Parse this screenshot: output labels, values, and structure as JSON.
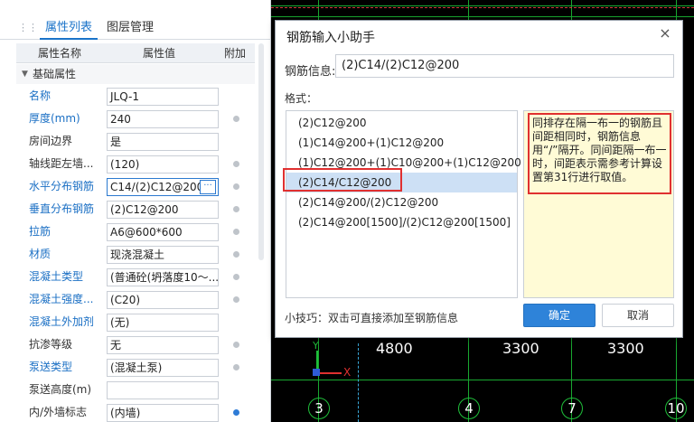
{
  "panel": {
    "tabs": [
      "属性列表",
      "图层管理"
    ],
    "columns": {
      "name": "属性名称",
      "value": "属性值",
      "extra": "附加"
    },
    "group_label": "基础属性",
    "rows": [
      {
        "name": "名称",
        "value": "JLQ-1"
      },
      {
        "name": "厚度(mm)",
        "value": "240"
      },
      {
        "name": "房间边界",
        "value": "是"
      },
      {
        "name": "轴线距左墙...",
        "value": "(120)"
      },
      {
        "name": "水平分布钢筋",
        "value": "C14/(2)C12@200"
      },
      {
        "name": "垂直分布钢筋",
        "value": "(2)C12@200"
      },
      {
        "name": "拉筋",
        "value": "A6@600*600"
      },
      {
        "name": "材质",
        "value": "现浇混凝土"
      },
      {
        "name": "混凝土类型",
        "value": "(普通砼(坍落度10～..."
      },
      {
        "name": "混凝土强度...",
        "value": "(C20)"
      },
      {
        "name": "混凝土外加剂",
        "value": "(无)"
      },
      {
        "name": "抗渗等级",
        "value": "无"
      },
      {
        "name": "泵送类型",
        "value": "(混凝土泵)"
      },
      {
        "name": "泵送高度(m)",
        "value": ""
      },
      {
        "name": "内/外墙标志",
        "value": "(内墙)"
      }
    ],
    "ellipsis_label": "···"
  },
  "dialog": {
    "title": "钢筋输入小助手",
    "close_icon": "×",
    "info_label": "钢筋信息:",
    "info_value": "(2)C14/(2)C12@200",
    "format_label": "格式：",
    "formats": [
      "(2)C12@200",
      "(1)C14@200+(1)C12@200",
      "(1)C12@200+(1)C10@200+(1)C12@200",
      "(2)C14/C12@200",
      "(2)C14@200/(2)C12@200",
      "(2)C14@200[1500]/(2)C12@200[1500]"
    ],
    "tip": "同排存在隔一布一的钢筋且间距相同时，钢筋信息用“/”隔开。同间距隔一布一时，间距表示需参考计算设置第31行进行取值。",
    "hint": "小技巧：双击可直接添加至钢筋信息",
    "ok_label": "确定",
    "cancel_label": "取消"
  },
  "cad": {
    "dimensions": [
      "4800",
      "3300",
      "3300"
    ],
    "axis_numbers": [
      "3",
      "4",
      "7",
      "10"
    ],
    "axis_y_label": "Y",
    "axis_x_label": "X"
  },
  "colors": {
    "accent": "#2e83d9",
    "highlight_red": "#e03030",
    "tip_background": "#fffbd6",
    "cad_green": "#18a830"
  }
}
